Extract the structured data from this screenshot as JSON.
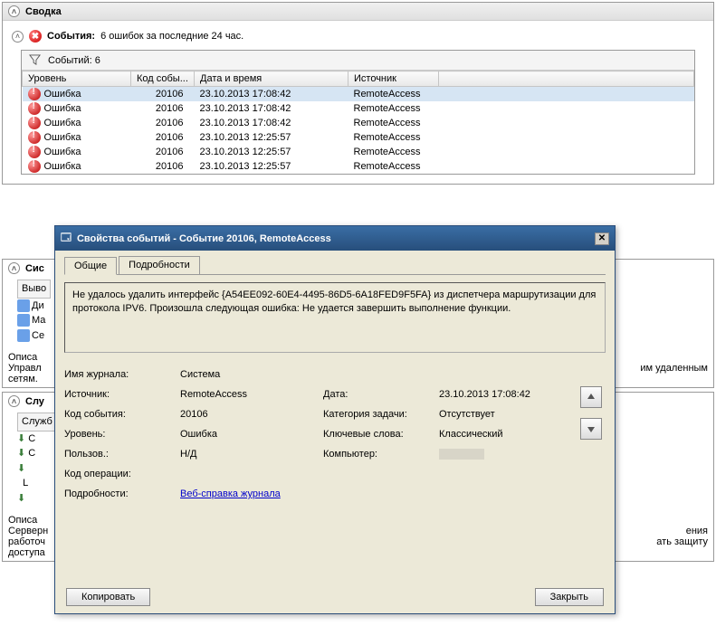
{
  "summary": {
    "title": "Сводка"
  },
  "events_header": {
    "label": "События:",
    "summary": "6 ошибок за последние 24 час."
  },
  "filter": {
    "count_label": "Событий: 6"
  },
  "columns": {
    "level": "Уровень",
    "code": "Код собы...",
    "datetime": "Дата и время",
    "source": "Источник"
  },
  "rows": [
    {
      "level": "Ошибка",
      "code": "20106",
      "dt": "23.10.2013 17:08:42",
      "src": "RemoteAccess"
    },
    {
      "level": "Ошибка",
      "code": "20106",
      "dt": "23.10.2013 17:08:42",
      "src": "RemoteAccess"
    },
    {
      "level": "Ошибка",
      "code": "20106",
      "dt": "23.10.2013 17:08:42",
      "src": "RemoteAccess"
    },
    {
      "level": "Ошибка",
      "code": "20106",
      "dt": "23.10.2013 12:25:57",
      "src": "RemoteAccess"
    },
    {
      "level": "Ошибка",
      "code": "20106",
      "dt": "23.10.2013 12:25:57",
      "src": "RemoteAccess"
    },
    {
      "level": "Ошибка",
      "code": "20106",
      "dt": "23.10.2013 12:25:57",
      "src": "RemoteAccess"
    }
  ],
  "dialog": {
    "title": "Свойства событий - Событие 20106, RemoteAccess",
    "tabs": {
      "general": "Общие",
      "details": "Подробности"
    },
    "message": "Не удалось удалить интерфейс {A54EE092-60E4-4495-86D5-6A18FED9F5FA} из диспетчера маршрутизации для протокола IPV6. Произошла следующая ошибка: Не удается завершить выполнение функции.",
    "labels": {
      "log": "Имя журнала:",
      "source": "Источник:",
      "eventid": "Код события:",
      "level": "Уровень:",
      "user": "Пользов.:",
      "opcode": "Код операции:",
      "details": "Подробности:",
      "date": "Дата:",
      "taskcat": "Категория задачи:",
      "keywords": "Ключевые слова:",
      "computer": "Компьютер:"
    },
    "values": {
      "log": "Система",
      "source": "RemoteAccess",
      "eventid": "20106",
      "level": "Ошибка",
      "user": "Н/Д",
      "opcode": "",
      "link": "Веб-справка журнала",
      "date": "23.10.2013 17:08:42",
      "taskcat": "Отсутствует",
      "keywords": "Классический",
      "computer": ""
    },
    "buttons": {
      "copy": "Копировать",
      "close": "Закрыть"
    }
  },
  "bg": {
    "sys": "Сис",
    "vyvo": "Выво",
    "di": "Ди",
    "ma": "Ма",
    "se": "Се",
    "opis": "Описа",
    "uprav": "Управл",
    "setyam": "сетям.",
    "slu": "Слу",
    "sluzhb": "Служб",
    "right1": "им удаленным",
    "right2": "ения",
    "right3": "ать защиту",
    "serv1": "Серверн",
    "serv2": "работоч",
    "serv3": "доступа"
  }
}
